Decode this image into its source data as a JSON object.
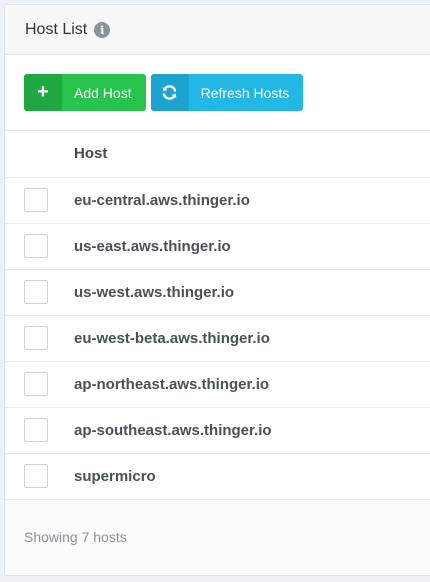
{
  "panel": {
    "title": "Host List",
    "info_icon": "i"
  },
  "toolbar": {
    "add_host": {
      "icon": "+",
      "label": "Add Host",
      "color": "#27c34d"
    },
    "refresh_hosts": {
      "icon": "refresh-icon",
      "label": "Refresh Hosts",
      "color": "#23b7e5"
    }
  },
  "table": {
    "columns": [
      "",
      "Host"
    ],
    "rows": [
      {
        "host": "eu-central.aws.thinger.io",
        "checked": false
      },
      {
        "host": "us-east.aws.thinger.io",
        "checked": false
      },
      {
        "host": "us-west.aws.thinger.io",
        "checked": false
      },
      {
        "host": "eu-west-beta.aws.thinger.io",
        "checked": false
      },
      {
        "host": "ap-northeast.aws.thinger.io",
        "checked": false
      },
      {
        "host": "ap-southeast.aws.thinger.io",
        "checked": false
      },
      {
        "host": "supermicro",
        "checked": false
      }
    ]
  },
  "footer": {
    "status": "Showing 7 hosts"
  }
}
